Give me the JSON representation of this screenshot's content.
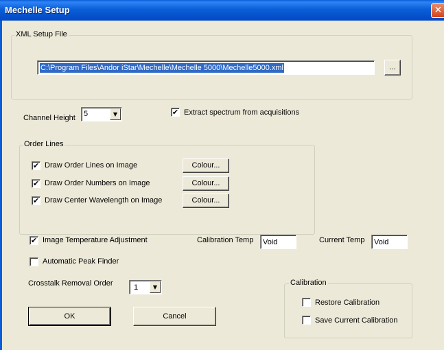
{
  "window": {
    "title": "Mechelle Setup",
    "close_glyph": "✕"
  },
  "xml_group": {
    "label": "XML Setup File",
    "path": "C:\\Program Files\\Andor iStar\\Mechelle\\Mechelle 5000\\Mechelle5000.xml",
    "browse_label": "..."
  },
  "channel": {
    "label": "Channel Height",
    "value": "5"
  },
  "extract": {
    "label": "Extract spectrum from acquisitions",
    "checked": true
  },
  "order_lines": {
    "label": "Order Lines",
    "items": [
      {
        "label": "Draw Order Lines on Image",
        "checked": true,
        "button": "Colour..."
      },
      {
        "label": "Draw Order Numbers on Image",
        "checked": true,
        "button": "Colour..."
      },
      {
        "label": "Draw Center Wavelength on Image",
        "checked": true,
        "button": "Colour..."
      }
    ]
  },
  "temp_adjust": {
    "label": "Image Temperature Adjustment",
    "checked": true
  },
  "calibration_temp": {
    "label": "Calibration Temp",
    "value": "Void"
  },
  "current_temp": {
    "label": "Current Temp",
    "value": "Void"
  },
  "peak_finder": {
    "label": "Automatic Peak Finder",
    "checked": false
  },
  "crosstalk": {
    "label": "Crosstalk Removal Order",
    "value": "1"
  },
  "calibration": {
    "label": "Calibration",
    "restore": {
      "label": "Restore Calibration",
      "checked": false
    },
    "save": {
      "label": "Save Current Calibration",
      "checked": false
    }
  },
  "buttons": {
    "ok": "OK",
    "cancel": "Cancel"
  },
  "glyphs": {
    "check": "✔",
    "dropdown": "▼"
  },
  "colors": {
    "title_bar": "#0a5fd8",
    "face": "#ece9d8",
    "selection": "#316ac5"
  }
}
